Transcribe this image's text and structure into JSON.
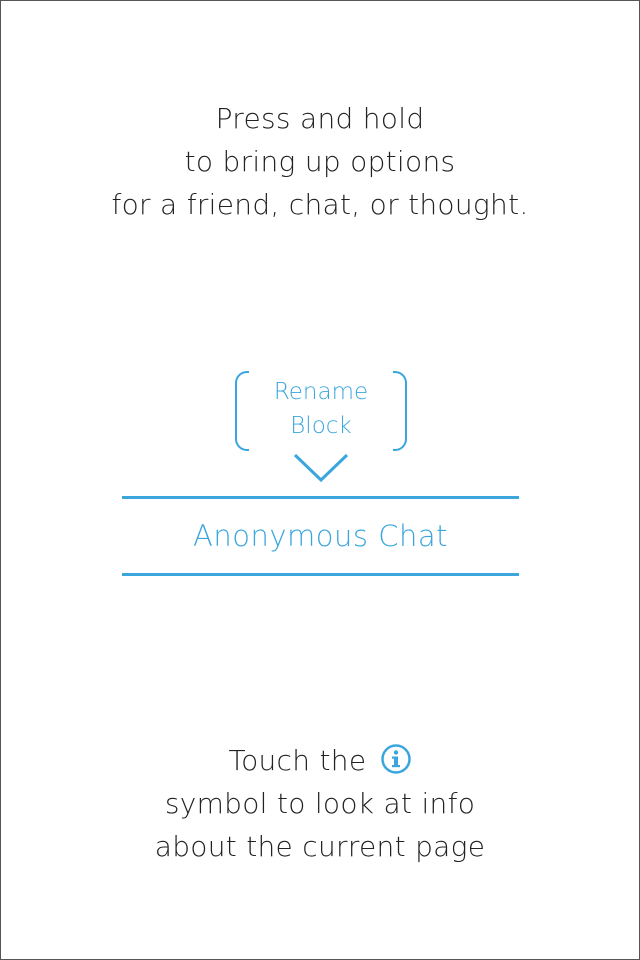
{
  "intro": {
    "lines": [
      "Press and hold",
      "to bring up options",
      "for a friend, chat, or thought."
    ]
  },
  "popup": {
    "options": [
      "Rename",
      "Block"
    ]
  },
  "chat_row": {
    "label": "Anonymous Chat"
  },
  "outro": {
    "line1": "Touch the",
    "line2": "symbol to look at info",
    "line3": "about the current page",
    "icon": "info-icon"
  },
  "colors": {
    "accent": "#3aa6dd",
    "text": "#222222",
    "background": "#ffffff"
  }
}
